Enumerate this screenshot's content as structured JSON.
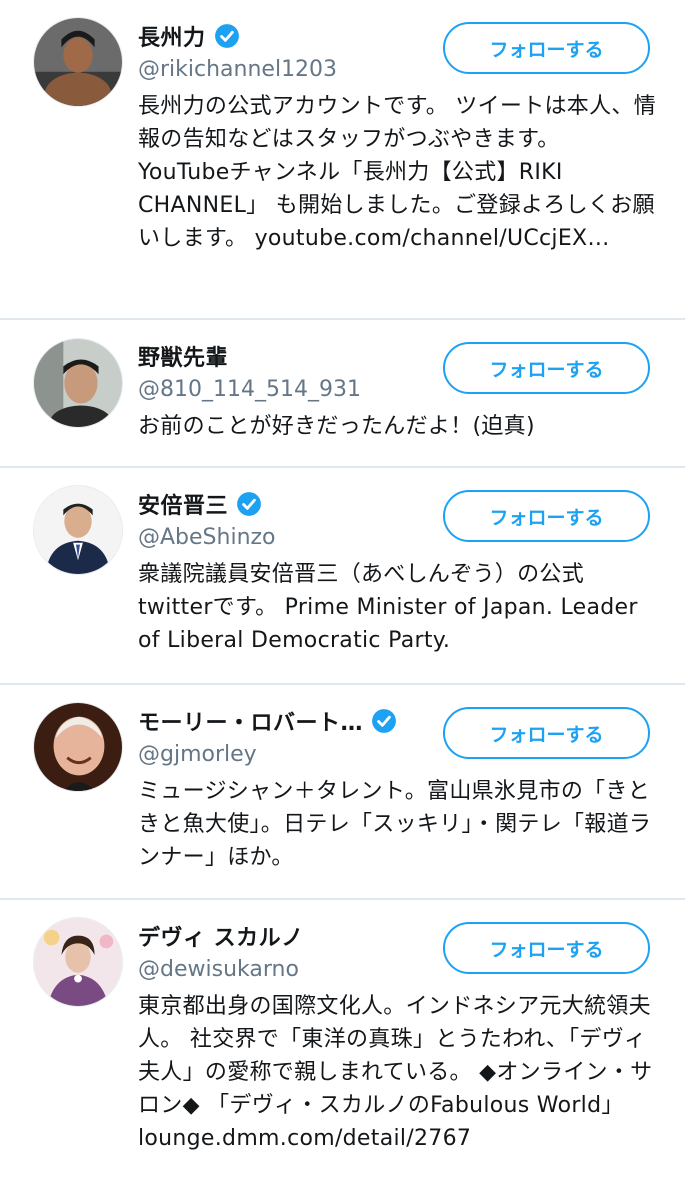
{
  "colors": {
    "accent": "#1da1f2",
    "separator": "#e1e8ed",
    "handle": "#657786",
    "text": "#14171a"
  },
  "users": [
    {
      "name": "長州力",
      "verified": true,
      "handle": "@rikichannel1203",
      "follow_label": "フォローする",
      "bio": "長州力の公式アカウントです。 ツイートは本人、情報の告知などはスタッフがつぶやきます。 YouTubeチャンネル「長州力【公式】RIKI CHANNEL」 も開始しました。ご登録よろしくお願いします。 youtube.com/channel/UCcjEX…"
    },
    {
      "name": "野獣先輩",
      "verified": false,
      "handle": "@810_114_514_931",
      "follow_label": "フォローする",
      "bio": "お前のことが好きだったんだよ！(迫真)"
    },
    {
      "name": "安倍晋三",
      "verified": true,
      "handle": "@AbeShinzo",
      "follow_label": "フォローする",
      "bio": "衆議院議員安倍晋三（あべしんぞう）の公式twitterです。 Prime Minister of Japan. Leader of Liberal Democratic Party."
    },
    {
      "name": "モーリー・ロバート…",
      "verified": true,
      "handle": "@gjmorley",
      "follow_label": "フォローする",
      "bio": "ミュージシャン＋タレント。富山県氷見市の「きときと魚大使」。日テレ「スッキリ」・関テレ「報道ランナー」ほか。"
    },
    {
      "name": "デヴィ スカルノ",
      "verified": false,
      "handle": "@dewisukarno",
      "follow_label": "フォローする",
      "bio": "東京都出身の国際文化人。インドネシア元大統領夫人。 社交界で「東洋の真珠」とうたわれ、「デヴィ夫人」の愛称で親しまれている。 ◆オンライン・サロン◆ 「デヴィ・スカルノのFabulous World」 lounge.dmm.com/detail/2767"
    }
  ]
}
